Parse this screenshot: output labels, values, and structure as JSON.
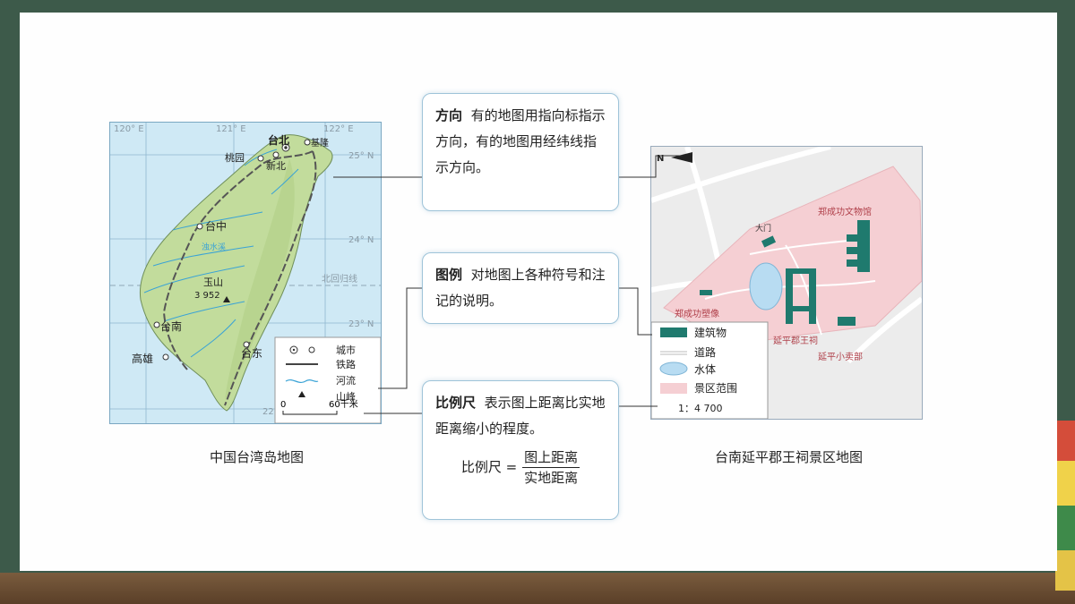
{
  "taiwan_map": {
    "caption": "中国台湾岛地图",
    "lon_labels": [
      "120° E",
      "121° E",
      "122° E"
    ],
    "lat_labels": [
      "25° N",
      "24° N",
      "23° N",
      "22° N"
    ],
    "tropic_label": "北回归线",
    "cities": [
      "台北",
      "基隆",
      "桃园",
      "新北",
      "台中",
      "台南",
      "高雄",
      "台东"
    ],
    "river_label": "浊水溪",
    "peak_name": "玉山",
    "peak_elevation": "3 952",
    "legend": {
      "city": "城市",
      "railway": "铁路",
      "river": "河流",
      "peak": "山峰"
    },
    "scale_zero": "0",
    "scale_end": "60千米"
  },
  "tainan_map": {
    "caption": "台南延平郡王祠景区地图",
    "north_label": "N",
    "places": [
      "郑成功文物馆",
      "郑成功塑像",
      "延平郡王祠",
      "延平小卖部"
    ],
    "gate_label": "大门",
    "legend": {
      "building": "建筑物",
      "road": "道路",
      "water": "水体",
      "scenic": "景区范围"
    },
    "scale_text": "1：4 700"
  },
  "callouts": {
    "direction": {
      "title": "方向",
      "text": "有的地图用指向标指示方向，有的地图用经纬线指示方向。"
    },
    "legend": {
      "title": "图例",
      "text": "对地图上各种符号和注记的说明。"
    },
    "scale": {
      "title": "比例尺",
      "text": "表示图上距离比实地距离缩小的程度。",
      "formula_left": "比例尺 =",
      "numerator": "图上距离",
      "denominator": "实地距离"
    }
  },
  "colors": {
    "land": "#c2dc9c",
    "sea": "#cfe9f5",
    "building": "#1f7a6e",
    "scenic": "#f5cfd3",
    "water": "#b8dcf2",
    "accent_text": "#b0404a"
  }
}
